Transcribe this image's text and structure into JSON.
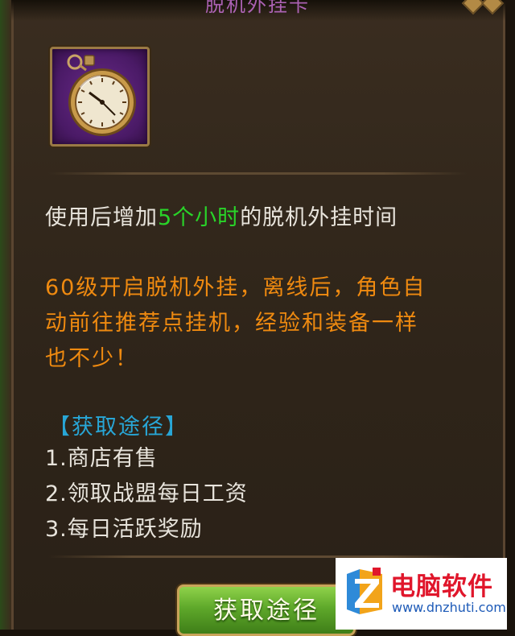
{
  "window": {
    "title": "脱机外挂卡"
  },
  "item": {
    "icon": "pocket-watch-icon"
  },
  "description": {
    "prefix": "使用后增加",
    "highlight": "5个小时",
    "suffix": "的脱机外挂时间",
    "highlight_color": "#29d429"
  },
  "notice": {
    "lines": [
      "60级开启脱机外挂，离线后，角色自",
      "动前往推荐点挂机，经验和装备一样",
      "也不少！"
    ],
    "color": "#ef8a10"
  },
  "source": {
    "title": "【获取途径】",
    "items": [
      "1.商店有售",
      "2.领取战盟每日工资",
      "3.每日活跃奖励"
    ]
  },
  "button": {
    "label": "获取途径"
  },
  "watermark": {
    "name": "电脑软件",
    "url": "www.dnzhuti.com",
    "logo": "z-logo-icon"
  }
}
